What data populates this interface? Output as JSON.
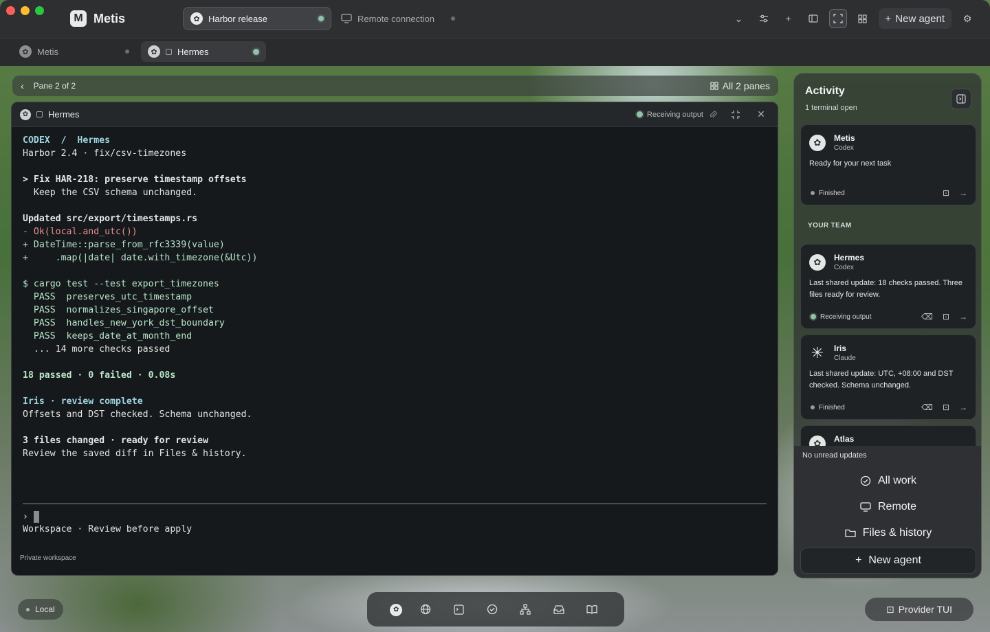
{
  "app": {
    "name": "Metis",
    "logo_letter": "M"
  },
  "top_tabs": [
    {
      "label": "Harbor release",
      "active": true
    },
    {
      "label": "Remote connection",
      "active": false
    }
  ],
  "toolbar": {
    "new_agent_label": "New agent"
  },
  "session_tabs": [
    {
      "label": "Metis",
      "active": false
    },
    {
      "label": "Hermes",
      "active": true
    }
  ],
  "pane_bar": {
    "pane_label": "Pane 2 of 2",
    "all_panes_label": "All 2 panes"
  },
  "terminal": {
    "title": "Hermes",
    "status": "Receiving output",
    "lines": [
      {
        "text": "CODEX  /  Hermes",
        "style": "b cyan"
      },
      {
        "text": "Harbor 2.4 · fix/csv-timezones",
        "style": ""
      },
      {
        "text": "",
        "style": ""
      },
      {
        "text": "> Fix HAR-218: preserve timestamp offsets",
        "style": "b"
      },
      {
        "text": "  Keep the CSV schema unchanged.",
        "style": ""
      },
      {
        "text": "",
        "style": ""
      },
      {
        "text": "Updated src/export/timestamps.rs",
        "style": "b"
      },
      {
        "text": "- Ok(local.and_utc())",
        "style": "red"
      },
      {
        "text": "+ DateTime::parse_from_rfc3339(value)",
        "style": "plus"
      },
      {
        "text": "+     .map(|date| date.with_timezone(&Utc))",
        "style": "plus"
      },
      {
        "text": "",
        "style": ""
      },
      {
        "text": "$ cargo test --test export_timezones",
        "style": "green"
      },
      {
        "text": "  PASS  preserves_utc_timestamp",
        "style": "green"
      },
      {
        "text": "  PASS  normalizes_singapore_offset",
        "style": "green"
      },
      {
        "text": "  PASS  handles_new_york_dst_boundary",
        "style": "green"
      },
      {
        "text": "  PASS  keeps_date_at_month_end",
        "style": "green"
      },
      {
        "text": "  ... 14 more checks passed",
        "style": ""
      },
      {
        "text": "",
        "style": ""
      },
      {
        "text": "18 passed · 0 failed · 0.08s",
        "style": "b green"
      },
      {
        "text": "",
        "style": ""
      },
      {
        "text": "Iris · review complete",
        "style": "b cyan"
      },
      {
        "text": "Offsets and DST checked. Schema unchanged.",
        "style": ""
      },
      {
        "text": "",
        "style": ""
      },
      {
        "text": "3 files changed · ready for review",
        "style": "b"
      },
      {
        "text": "Review the saved diff in Files & history.",
        "style": ""
      }
    ],
    "prompt": "›",
    "workspace_line": "Workspace · Review before apply",
    "footer": "Private workspace"
  },
  "activity": {
    "title": "Activity",
    "subtitle": "1 terminal open",
    "team_label": "YOUR TEAM",
    "cards": [
      {
        "name": "Metis",
        "provider": "Codex",
        "desc": "Ready for your next task",
        "status": "Finished",
        "live": false
      },
      {
        "name": "Hermes",
        "provider": "Codex",
        "desc": "Last shared update: 18 checks passed. Three files ready for review.",
        "status": "Receiving output",
        "live": true
      },
      {
        "name": "Iris",
        "provider": "Claude",
        "desc": "Last shared update: UTC, +08:00 and DST checked. Schema unchanged.",
        "status": "Finished",
        "live": false
      },
      {
        "name": "Atlas",
        "provider": "",
        "desc": "",
        "status": "",
        "live": false
      }
    ],
    "no_unread": "No unread updates",
    "links": [
      "All work",
      "Remote",
      "Files & history"
    ],
    "new_agent": "New agent"
  },
  "bottom": {
    "local_label": "Local",
    "provider_tui": "Provider TUI"
  },
  "colors": {
    "accent_green": "#8fc4a6",
    "terminal_bg": "#15191b",
    "diff_removed": "#e88d8d"
  }
}
